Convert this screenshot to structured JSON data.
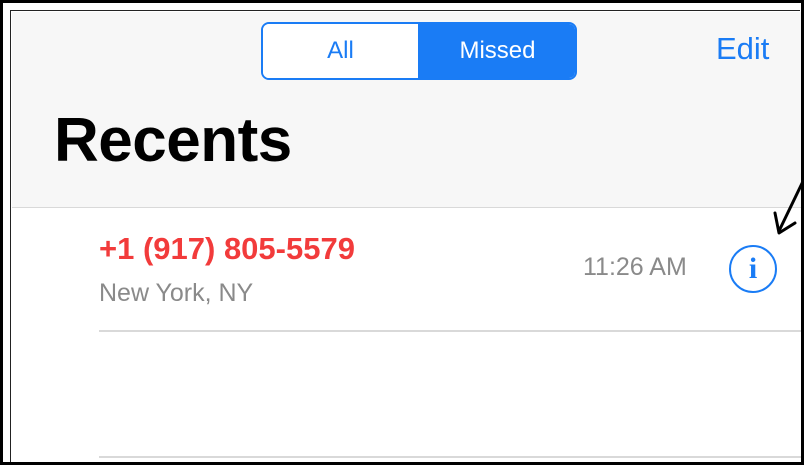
{
  "segmented_control": {
    "all_label": "All",
    "missed_label": "Missed",
    "selected": "Missed"
  },
  "nav": {
    "edit_label": "Edit"
  },
  "page": {
    "title": "Recents"
  },
  "calls": [
    {
      "number": "+1 (917) 805-5579",
      "location": "New York, NY",
      "time": "11:26 AM",
      "info_icon": "info-icon"
    }
  ],
  "colors": {
    "accent": "#1a7cf5",
    "missed_call": "#f23b3b",
    "secondary_text": "#8a8a8a"
  }
}
